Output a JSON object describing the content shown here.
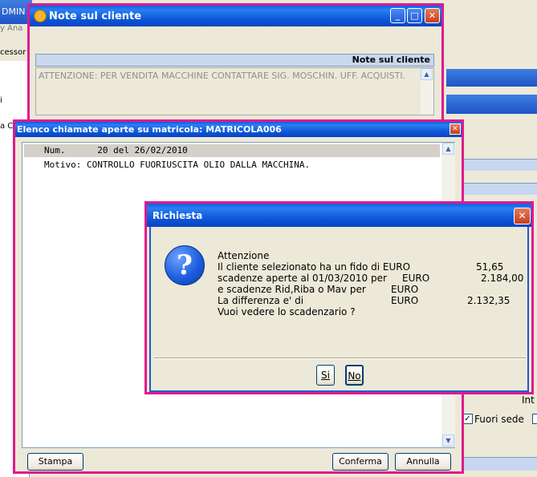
{
  "background": {
    "title_fragment": "DMIN",
    "menu_fragment": "y   Ana",
    "toolbar_fragment": "cessor",
    "side_fragment_1": "i",
    "side_fragment_2": "a C",
    "int_label": "Int",
    "fuori_sede_label": "Fuori sede",
    "fuori_sede_checked": true
  },
  "note_window": {
    "title": "Note sul cliente",
    "header": "Note sul cliente",
    "text": "ATTENZIONE: PER VENDITA MACCHINE CONTATTARE SIG. MOSCHIN. UFF. ACQUISTI."
  },
  "elenco_window": {
    "title": "Elenco chiamate aperte su matricola: MATRICOLA006",
    "row1": "Num.      20 del 26/02/2010",
    "row2": "Motivo: CONTROLLO FUORIUSCITA OLIO DALLA MACCHINA.",
    "buttons": {
      "stampa": "Stampa",
      "conferma": "Conferma",
      "annulla": "Annulla"
    }
  },
  "dialog": {
    "title": "Richiesta",
    "lines": [
      {
        "label": "Attenzione",
        "unit": "",
        "value": ""
      },
      {
        "label": "Il cliente selezionato ha un fido di EURO",
        "unit": "",
        "value": "51,65"
      },
      {
        "label": "scadenze aperte al 01/03/2010 per",
        "unit": "EURO",
        "value": "2.184,00"
      },
      {
        "label": "e scadenze Rid,Riba o Mav per",
        "unit": "EURO",
        "value": ""
      },
      {
        "label": "La differenza e' di",
        "unit": "EURO",
        "value": "2.132,35"
      },
      {
        "label": "Vuoi vedere lo scadenzario ?",
        "unit": "",
        "value": ""
      }
    ],
    "buttons": {
      "yes": "Si",
      "no": "No"
    }
  }
}
